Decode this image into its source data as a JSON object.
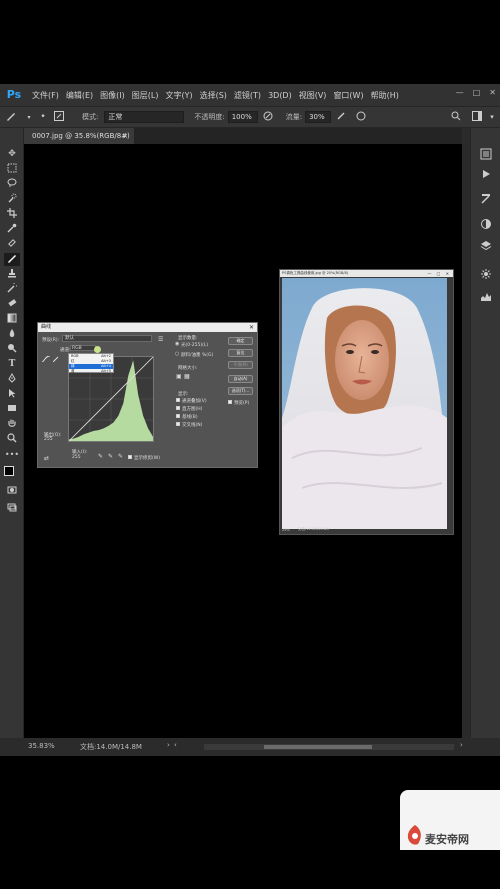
{
  "app": {
    "logo": "Ps"
  },
  "menubar": {
    "items": [
      "文件(F)",
      "编辑(E)",
      "图像(I)",
      "图层(L)",
      "文字(Y)",
      "选择(S)",
      "滤镜(T)",
      "3D(D)",
      "视图(V)",
      "窗口(W)",
      "帮助(H)"
    ],
    "window_controls": [
      "—",
      "□",
      "✕"
    ]
  },
  "options": {
    "mode_label": "模式:",
    "mode_value": "正常",
    "opacity_label": "不透明度:",
    "opacity_value": "100%",
    "flow_label": "流量:",
    "flow_value": "30%"
  },
  "document": {
    "tab_title": "0007.jpg @ 35.8%(RGB/8#)",
    "tab_close": "×"
  },
  "status": {
    "zoom": "35.83%",
    "doc_info": "文档:14.0M/14.8M"
  },
  "curves_dialog": {
    "title": "曲线",
    "preset_label": "预设(R):",
    "preset_value": "默认",
    "channel_label": "通道:",
    "channel_value": "RGB",
    "channel_options": [
      {
        "name": "RGB",
        "shortcut": "Alt+2"
      },
      {
        "name": "红",
        "shortcut": "Alt+3"
      },
      {
        "name": "绿",
        "shortcut": "Alt+4"
      },
      {
        "name": "蓝",
        "shortcut": "Alt+5"
      }
    ],
    "output_label": "输出(O):",
    "output_value": "255",
    "input_label": "输入(I):",
    "input_value": "255",
    "show_clipping": "显示修剪(W)",
    "display_options_title": "显示数量:",
    "light_option": "光(0-255)(L)",
    "pigment_option": "颜料/油墨 %(G)",
    "grid_size_label": "网格大小:",
    "show_title": "显示:",
    "show_options": [
      "通道叠加(V)",
      "直方图(H)",
      "基线(B)",
      "交叉线(N)"
    ],
    "buttons": {
      "ok": "确定",
      "reset": "复位",
      "smooth": "平滑(M)",
      "auto": "自动(A)",
      "options": "选项(T)..."
    },
    "preview_label": "预览(P)"
  },
  "photo_window": {
    "title": "PS调色工具曲线使用.jpg @ 25%(RGB/8)",
    "zoom": "25%",
    "status": "文档:14.0M/14.8M"
  },
  "watermark": {
    "text": "麦安帝网"
  },
  "chart_data": {
    "type": "area",
    "title": "",
    "x": [
      0,
      15,
      30,
      45,
      60,
      75,
      90,
      105,
      120,
      135,
      150,
      165,
      180,
      195,
      210,
      225,
      240,
      255
    ],
    "values": [
      2,
      3,
      5,
      8,
      10,
      12,
      13,
      15,
      18,
      22,
      30,
      45,
      78,
      96,
      55,
      30,
      15,
      5
    ],
    "xlim": [
      0,
      255
    ],
    "ylim": [
      0,
      100
    ],
    "grid": true,
    "colors": {
      "histogram": "#b6dba0",
      "curve": "#e0e0e0"
    }
  },
  "colors": {
    "accent": "#31a8ff",
    "selection": "#1e6ed6",
    "bg": "#2b2b2b"
  }
}
